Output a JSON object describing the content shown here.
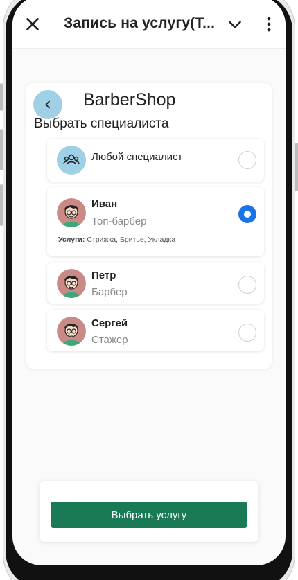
{
  "appbar": {
    "title": "Запись на услугу(Т...",
    "close_icon": "close-icon",
    "expand_icon": "chevron-down-icon",
    "more_icon": "more-vertical-icon"
  },
  "page": {
    "brand": "BarberShop",
    "section_title": "Выбрать специалиста",
    "back_icon": "chevron-left-icon"
  },
  "specialists": [
    {
      "name": "Любой специалист",
      "role": "",
      "selected": false,
      "icon": "group-icon"
    },
    {
      "name": "Иван",
      "role": "Топ-барбер",
      "selected": true,
      "services_label": "Услуги:",
      "services": "Стрижка, Бритье, Укладка",
      "icon": "person-avatar-icon"
    },
    {
      "name": "Петр",
      "role": "Барбер",
      "selected": false,
      "icon": "person-avatar-icon"
    },
    {
      "name": "Сергей",
      "role": "Стажер",
      "selected": false,
      "icon": "person-avatar-icon"
    }
  ],
  "footer": {
    "button_label": "Выбрать услугу"
  },
  "colors": {
    "accent_blue": "#1a73e8",
    "primary_green": "#1a7a55",
    "avatar_bg": "#9fd0e6",
    "person_avatar_bg": "#c98a86"
  }
}
